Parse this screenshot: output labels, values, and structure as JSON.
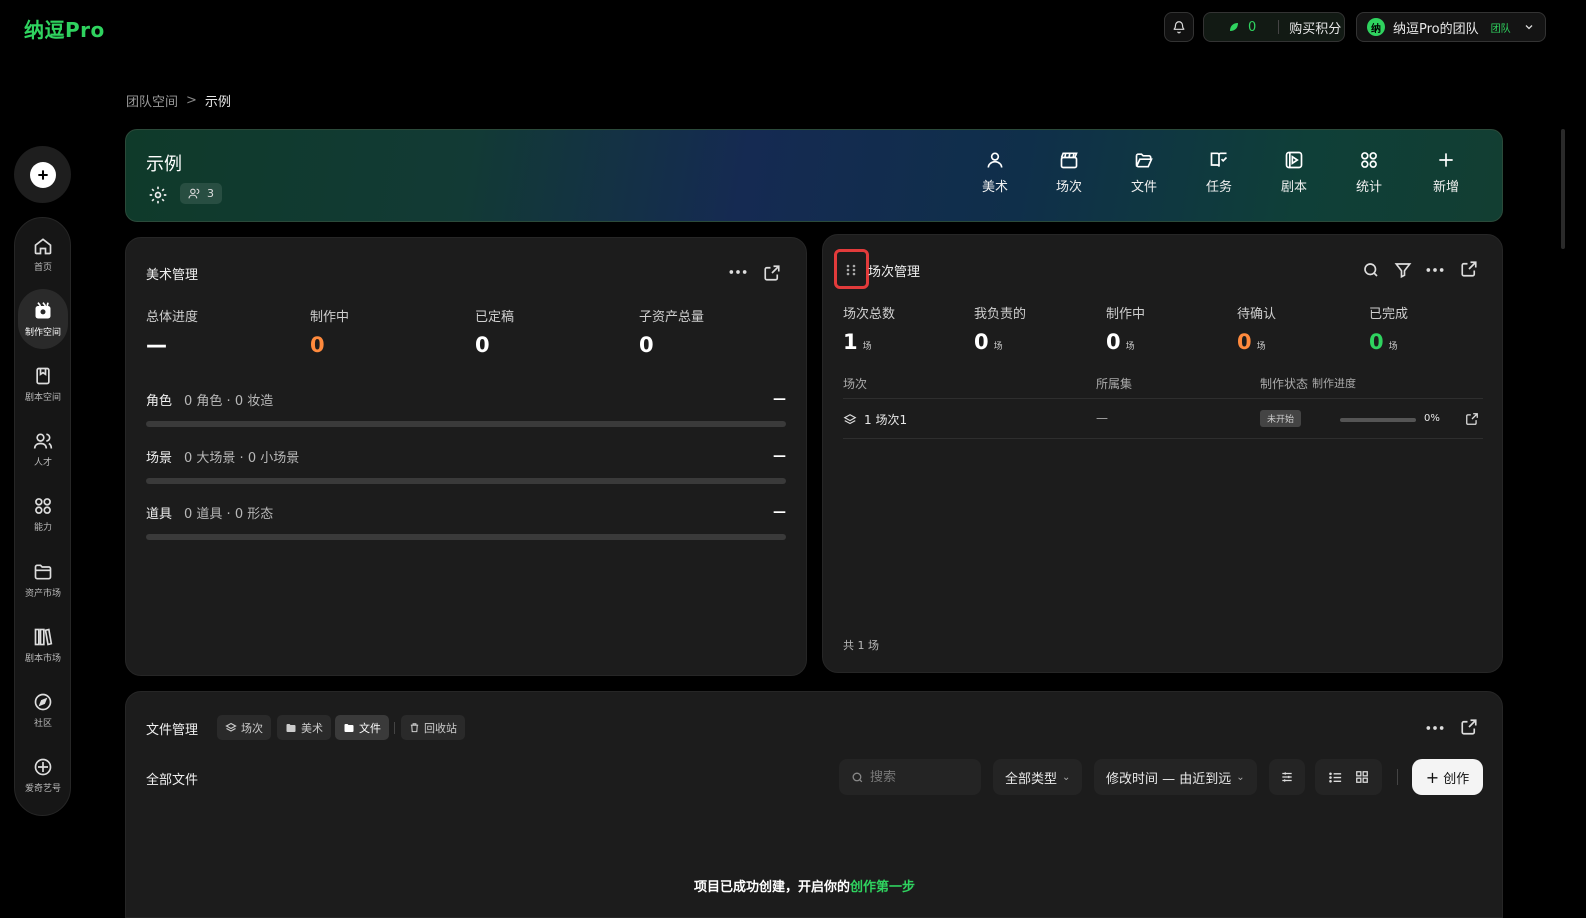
{
  "brand": {
    "logo": "纳逗Pro",
    "accent": "#2fd35f"
  },
  "topbar": {
    "points_value": "0",
    "buy_points": "购买积分",
    "team_avatar": "纳",
    "team_name": "纳逗Pro的团队",
    "team_tag": "团队"
  },
  "sidebar": {
    "items": [
      {
        "label": "首页",
        "icon": "home-icon"
      },
      {
        "label": "制作空间",
        "icon": "studio-icon",
        "active": true
      },
      {
        "label": "剧本空间",
        "icon": "script-icon"
      },
      {
        "label": "人才",
        "icon": "people-icon"
      },
      {
        "label": "能力",
        "icon": "grid-icon"
      },
      {
        "label": "资产市场",
        "icon": "folder-icon"
      },
      {
        "label": "剧本市场",
        "icon": "library-icon"
      },
      {
        "label": "社区",
        "icon": "compass-icon"
      },
      {
        "label": "爱奇艺号",
        "icon": "iqiyi-icon"
      }
    ]
  },
  "breadcrumb": {
    "parent": "团队空间",
    "separator": ">",
    "current": "示例"
  },
  "project": {
    "title": "示例",
    "member_count": "3",
    "tools": [
      "美术",
      "场次",
      "文件",
      "任务",
      "剧本",
      "统计",
      "新增"
    ]
  },
  "art": {
    "title": "美术管理",
    "stats": [
      {
        "label": "总体进度",
        "value": "—",
        "color": "white"
      },
      {
        "label": "制作中",
        "value": "0",
        "color": "orange"
      },
      {
        "label": "已定稿",
        "value": "0",
        "color": "white"
      },
      {
        "label": "子资产总量",
        "value": "0",
        "color": "white"
      }
    ],
    "rows": [
      {
        "name": "角色",
        "meta": "0 角色 · 0 妆造",
        "value": "—"
      },
      {
        "name": "场景",
        "meta": "0 大场景 · 0 小场景",
        "value": "—"
      },
      {
        "name": "道具",
        "meta": "0 道具 · 0 形态",
        "value": "—"
      }
    ]
  },
  "scene": {
    "title": "场次管理",
    "unit": "场",
    "stats": [
      {
        "label": "场次总数",
        "value": "1",
        "color": "white"
      },
      {
        "label": "我负责的",
        "value": "0",
        "color": "white"
      },
      {
        "label": "制作中",
        "value": "0",
        "color": "white"
      },
      {
        "label": "待确认",
        "value": "0",
        "color": "orange"
      },
      {
        "label": "已完成",
        "value": "0",
        "color": "green"
      }
    ],
    "columns": [
      "场次",
      "所属集",
      "制作状态",
      "制作进度"
    ],
    "rows": [
      {
        "name": "1 场次1",
        "episode": "—",
        "status": "未开始",
        "progress_text": "0%",
        "progress": 0
      }
    ],
    "footer": "共 1 场"
  },
  "files": {
    "title": "文件管理",
    "tabs": [
      {
        "label": "场次",
        "active": false
      },
      {
        "label": "美术",
        "active": false
      },
      {
        "label": "文件",
        "active": true
      }
    ],
    "trash": "回收站",
    "section": "全部文件",
    "search_placeholder": "搜索",
    "type_filter": "全部类型",
    "sort": "修改时间 — 由近到远",
    "create": "创作",
    "hint_prefix": "项目已成功创建，开启你的",
    "hint_link": "创作第一步"
  }
}
